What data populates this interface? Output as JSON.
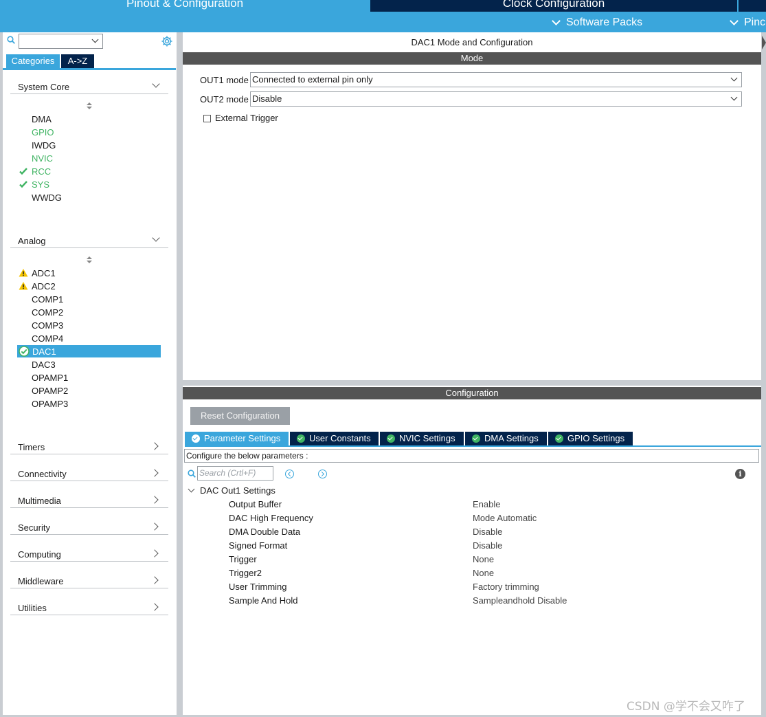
{
  "topbar": {
    "tab_pinout": "Pinout & Configuration",
    "tab_clock": "Clock Configuration",
    "software_packs": "Software Packs",
    "pinout_sub": "Pinc"
  },
  "sidebar": {
    "tabs": {
      "categories": "Categories",
      "az": "A->Z"
    },
    "system_core": {
      "label": "System Core",
      "items": [
        {
          "label": "DMA",
          "status": "none"
        },
        {
          "label": "GPIO",
          "status": "configured"
        },
        {
          "label": "IWDG",
          "status": "none"
        },
        {
          "label": "NVIC",
          "status": "configured"
        },
        {
          "label": "RCC",
          "status": "ok"
        },
        {
          "label": "SYS",
          "status": "ok"
        },
        {
          "label": "WWDG",
          "status": "none"
        }
      ]
    },
    "analog": {
      "label": "Analog",
      "items": [
        {
          "label": "ADC1",
          "status": "warning"
        },
        {
          "label": "ADC2",
          "status": "warning"
        },
        {
          "label": "COMP1",
          "status": "none"
        },
        {
          "label": "COMP2",
          "status": "none"
        },
        {
          "label": "COMP3",
          "status": "none"
        },
        {
          "label": "COMP4",
          "status": "none"
        },
        {
          "label": "DAC1",
          "status": "selected"
        },
        {
          "label": "DAC3",
          "status": "none"
        },
        {
          "label": "OPAMP1",
          "status": "none"
        },
        {
          "label": "OPAMP2",
          "status": "none"
        },
        {
          "label": "OPAMP3",
          "status": "none"
        }
      ]
    },
    "collapsed_sections": [
      "Timers",
      "Connectivity",
      "Multimedia",
      "Security",
      "Computing",
      "Middleware",
      "Utilities"
    ]
  },
  "mode_pane": {
    "title": "DAC1 Mode and Configuration",
    "mode_header": "Mode",
    "out1_label": "OUT1 mode",
    "out1_value": "Connected to external pin only",
    "out2_label": "OUT2 mode",
    "out2_value": "Disable",
    "external_trigger_label": "External Trigger",
    "external_trigger_checked": false
  },
  "config_pane": {
    "header": "Configuration",
    "reset_label": "Reset Configuration",
    "tabs": [
      "Parameter Settings",
      "User Constants",
      "NVIC Settings",
      "DMA Settings",
      "GPIO Settings"
    ],
    "active_tab": "Parameter Settings",
    "configure_text": "Configure the below parameters :",
    "search_placeholder": "Search (Crtl+F)",
    "group_title": "DAC Out1 Settings",
    "params": [
      {
        "name": "Output Buffer",
        "value": "Enable"
      },
      {
        "name": "DAC High Frequency",
        "value": "Mode Automatic"
      },
      {
        "name": "DMA Double Data",
        "value": "Disable"
      },
      {
        "name": "Signed Format",
        "value": "Disable"
      },
      {
        "name": "Trigger",
        "value": "None"
      },
      {
        "name": "Trigger2",
        "value": "None"
      },
      {
        "name": "User Trimming",
        "value": "Factory trimming"
      },
      {
        "name": "Sample And Hold",
        "value": "Sampleandhold Disable"
      }
    ]
  },
  "watermark": "CSDN @学不会又咋了",
  "colors": {
    "accent_blue": "#3aa6dc",
    "navy": "#03234b",
    "configured_green": "#40b463",
    "warning_yellow": "#f5c400",
    "header_gray": "#545454"
  }
}
